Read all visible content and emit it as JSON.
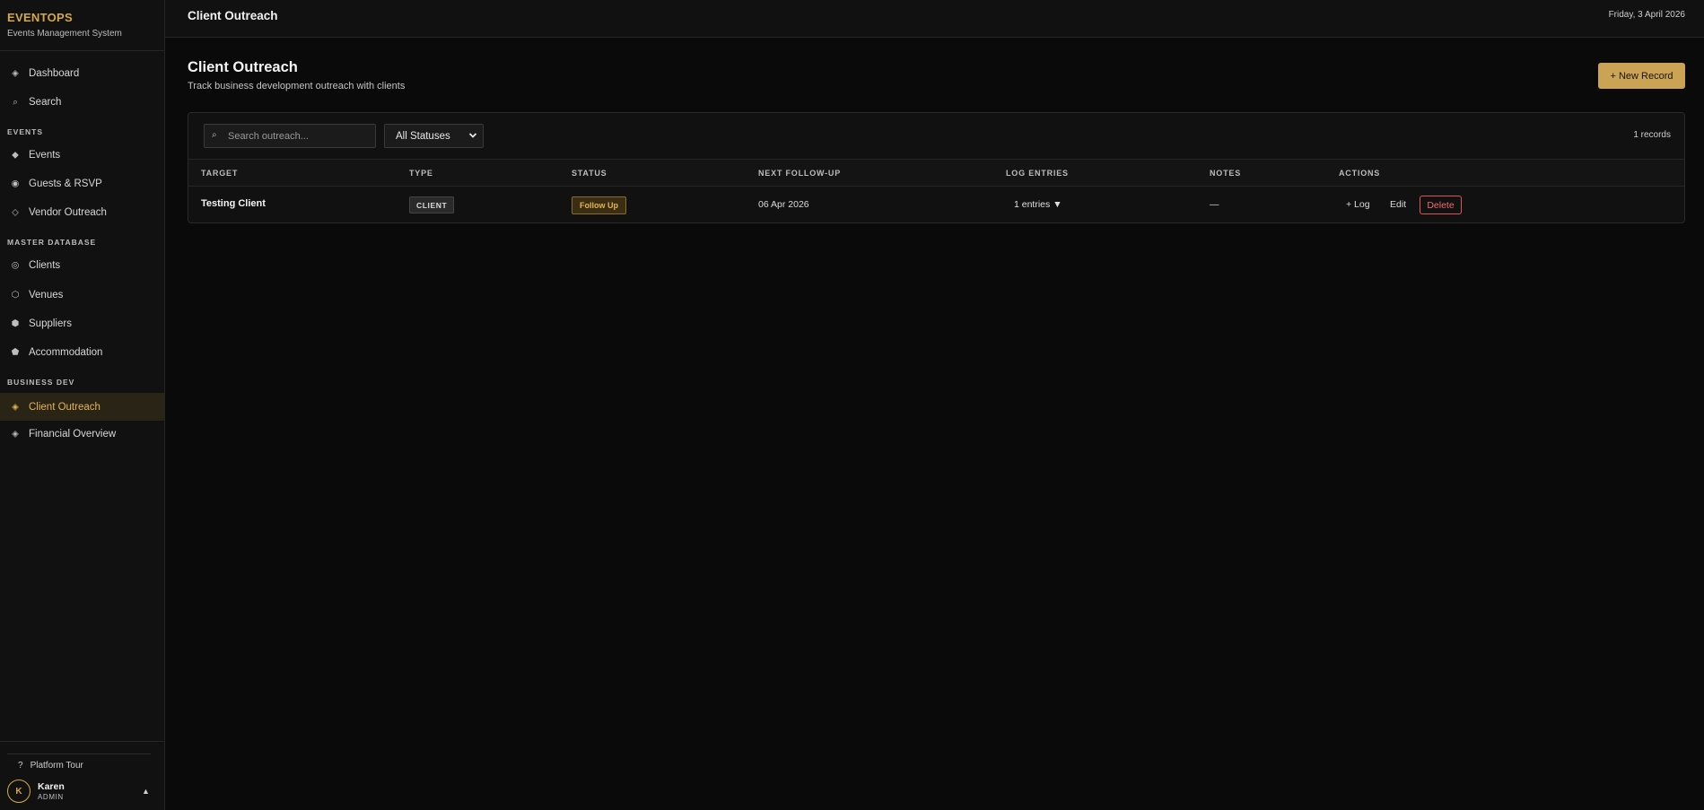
{
  "brand": {
    "title": "EVENTOPS",
    "subtitle": "Events Management System"
  },
  "sidebar": {
    "top_items": [
      {
        "label": "Dashboard",
        "icon": "◈"
      },
      {
        "label": "Search",
        "icon": "⌕"
      }
    ],
    "sections": [
      {
        "label": "EVENTS",
        "items": [
          {
            "label": "Events",
            "icon": "◆"
          },
          {
            "label": "Guests & RSVP",
            "icon": "◉"
          },
          {
            "label": "Vendor Outreach",
            "icon": "◇"
          }
        ]
      },
      {
        "label": "MASTER DATABASE",
        "items": [
          {
            "label": "Clients",
            "icon": "◎"
          },
          {
            "label": "Venues",
            "icon": "⬡"
          },
          {
            "label": "Suppliers",
            "icon": "⬢"
          },
          {
            "label": "Accommodation",
            "icon": "⬟"
          }
        ]
      },
      {
        "label": "BUSINESS DEV",
        "items": [
          {
            "label": "Client Outreach",
            "icon": "◈"
          },
          {
            "label": "Financial Overview",
            "icon": "◈"
          }
        ]
      }
    ],
    "active": "Client Outreach",
    "tour": {
      "label": "Platform Tour",
      "icon": "?"
    },
    "user": {
      "initial": "K",
      "name": "Karen",
      "role": "ADMIN",
      "caret": "▲"
    }
  },
  "topbar": {
    "title": "Client Outreach",
    "date": "Friday, 3 April 2026"
  },
  "page": {
    "title": "Client Outreach",
    "subtitle": "Track business development outreach with clients",
    "new_button": "+ New Record"
  },
  "filters": {
    "search_placeholder": "Search outreach...",
    "search_value": "",
    "search_icon": "⌕",
    "status_selected": "All Statuses",
    "records": "1 records"
  },
  "table": {
    "headers": [
      "TARGET",
      "TYPE",
      "STATUS",
      "NEXT FOLLOW-UP",
      "LOG ENTRIES",
      "NOTES",
      "ACTIONS"
    ],
    "rows": [
      {
        "target": "Testing Client",
        "type": "CLIENT",
        "status": "Follow Up",
        "next_follow_up": "06 Apr 2026",
        "log_entries": "1 entries",
        "log_caret": "▼",
        "notes": "—",
        "actions": {
          "log": "+ Log",
          "edit": "Edit",
          "delete": "Delete"
        }
      }
    ]
  },
  "colors": {
    "accent": "#d4a94a",
    "danger": "#e0545a",
    "background": "#0a0a0a",
    "panel": "#111111"
  }
}
